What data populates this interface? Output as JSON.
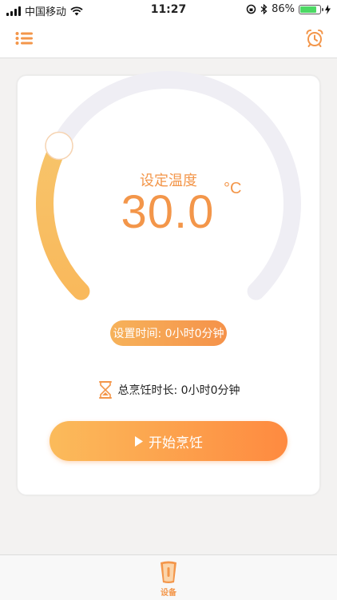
{
  "status": {
    "carrier": "中国移动",
    "time": "11:27",
    "battery": "86%",
    "battery_level": 0.86
  },
  "nav": {
    "menu_icon": "list-icon",
    "alarm_icon": "alarm-clock-icon"
  },
  "dial": {
    "title": "设定温度",
    "value": "30.0",
    "unit": "°C",
    "level": 0.27,
    "track_color": "#efeef4",
    "active_color_start": "#f9b95c",
    "active_color_end": "#f7c46a"
  },
  "set_time": {
    "label": "设置时间: 0小时0分钟"
  },
  "total": {
    "label": "总烹饪时长: 0小时0分钟",
    "icon": "hourglass-icon"
  },
  "start": {
    "label": "开始烹饪",
    "icon": "play-icon"
  },
  "tabs": [
    {
      "label": "设备",
      "icon": "cup-icon"
    }
  ],
  "colors": {
    "accent": "#f3964a",
    "battery_fill": "#4cd964"
  }
}
